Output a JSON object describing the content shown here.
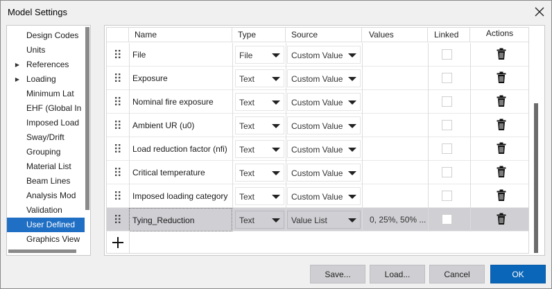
{
  "window": {
    "title": "Model Settings",
    "close_icon": "close-icon"
  },
  "sidebar": {
    "items": [
      {
        "label": "Design Codes",
        "expandable": false,
        "selected": false
      },
      {
        "label": "Units",
        "expandable": false,
        "selected": false
      },
      {
        "label": "References",
        "expandable": true,
        "selected": false
      },
      {
        "label": "Loading",
        "expandable": true,
        "selected": false
      },
      {
        "label": "Minimum Lat",
        "expandable": false,
        "selected": false
      },
      {
        "label": "EHF (Global In",
        "expandable": false,
        "selected": false
      },
      {
        "label": "Imposed Load",
        "expandable": false,
        "selected": false
      },
      {
        "label": "Sway/Drift",
        "expandable": false,
        "selected": false
      },
      {
        "label": "Grouping",
        "expandable": false,
        "selected": false
      },
      {
        "label": "Material List",
        "expandable": false,
        "selected": false
      },
      {
        "label": "Beam Lines",
        "expandable": false,
        "selected": false
      },
      {
        "label": "Analysis Mod",
        "expandable": false,
        "selected": false
      },
      {
        "label": "Validation",
        "expandable": false,
        "selected": false
      },
      {
        "label": "User Defined",
        "expandable": false,
        "selected": true
      },
      {
        "label": "Graphics View",
        "expandable": false,
        "selected": false
      }
    ]
  },
  "table": {
    "columns": {
      "name": "Name",
      "type": "Type",
      "source": "Source",
      "values": "Values",
      "linked": "Linked",
      "actions": "Actions"
    },
    "rows": [
      {
        "name": "File",
        "type": "File",
        "source": "Custom Value",
        "values": "",
        "linked": false,
        "selected": false
      },
      {
        "name": "Exposure",
        "type": "Text",
        "source": "Custom Value",
        "values": "",
        "linked": false,
        "selected": false
      },
      {
        "name": "Nominal fire exposure",
        "type": "Text",
        "source": "Custom Value",
        "values": "",
        "linked": false,
        "selected": false
      },
      {
        "name": "Ambient UR (u0)",
        "type": "Text",
        "source": "Custom Value",
        "values": "",
        "linked": false,
        "selected": false
      },
      {
        "name": "Load reduction factor (nfi)",
        "type": "Text",
        "source": "Custom Value",
        "values": "",
        "linked": false,
        "selected": false
      },
      {
        "name": "Critical temperature",
        "type": "Text",
        "source": "Custom Value",
        "values": "",
        "linked": false,
        "selected": false
      },
      {
        "name": "Imposed loading category",
        "type": "Text",
        "source": "Custom Value",
        "values": "",
        "linked": false,
        "selected": false
      },
      {
        "name": "Tying_Reduction",
        "type": "Text",
        "source": "Value List",
        "values": "0, 25%, 50% ...",
        "linked": false,
        "selected": true
      }
    ],
    "add_icon": "plus-icon",
    "drag_icon": "drag-handle-icon",
    "delete_icon": "trash-icon"
  },
  "buttons": {
    "save": "Save...",
    "load": "Load...",
    "cancel": "Cancel",
    "ok": "OK"
  },
  "colors": {
    "selection": "#1f6fc5",
    "primary_button": "#0a66b8",
    "selected_row": "#cfcfd4"
  }
}
